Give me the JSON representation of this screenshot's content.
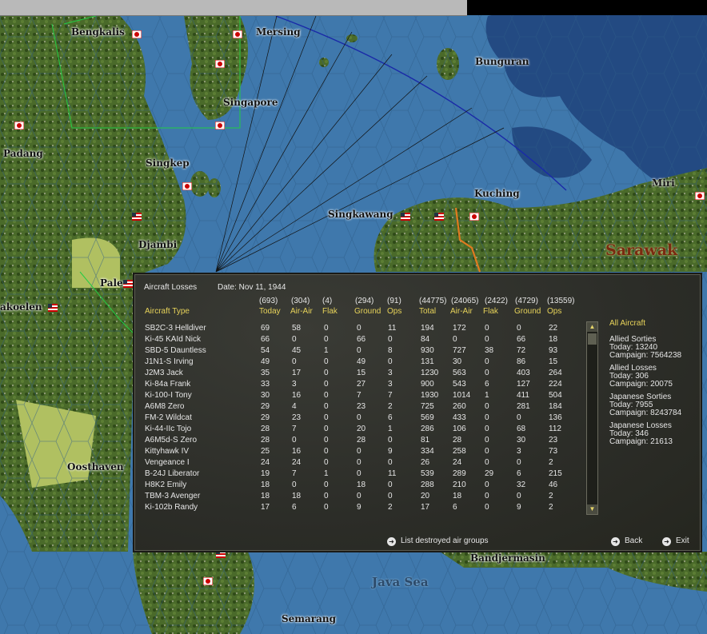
{
  "map": {
    "places": [
      {
        "name": "Bengkalis",
        "kind": "town"
      },
      {
        "name": "Mersing",
        "kind": "town"
      },
      {
        "name": "Bunguran",
        "kind": "town"
      },
      {
        "name": "Singapore",
        "kind": "town"
      },
      {
        "name": "Padang",
        "kind": "town"
      },
      {
        "name": "Singkep",
        "kind": "town"
      },
      {
        "name": "Kuching",
        "kind": "town"
      },
      {
        "name": "Miri",
        "kind": "town"
      },
      {
        "name": "Singkawang",
        "kind": "town"
      },
      {
        "name": "Djambi",
        "kind": "town"
      },
      {
        "name": "Sarawak",
        "kind": "region"
      },
      {
        "name": "Paler",
        "kind": "town"
      },
      {
        "name": "akoelen",
        "kind": "town"
      },
      {
        "name": "Oosthaven",
        "kind": "town"
      },
      {
        "name": "Bandjermasin",
        "kind": "town"
      },
      {
        "name": "Java Sea",
        "kind": "sea"
      },
      {
        "name": "Semarang",
        "kind": "town"
      }
    ],
    "colors": {
      "sea": "#3f78ac",
      "land": "#4c6e2c",
      "cloud": "#234a82",
      "hex_line": "#2d5c88",
      "green_zone": "#22cc44",
      "blue_arc": "#1a2aa8"
    }
  },
  "panel": {
    "title": "Aircraft Losses",
    "date": "Date: Nov 11, 1944",
    "totals": [
      "(693)",
      "(304)",
      "(4)",
      "(294)",
      "(91)",
      "(44775)",
      "(24065)",
      "(2422)",
      "(4729)",
      "(13559)"
    ],
    "col_label": "Aircraft Type",
    "columns": [
      "Today",
      "Air-Air",
      "Flak",
      "Ground",
      "Ops",
      "Total",
      "Air-Air",
      "Flak",
      "Ground",
      "Ops"
    ],
    "rows": [
      [
        "SB2C-3 Helldiver",
        "69",
        "58",
        "0",
        "0",
        "11",
        "194",
        "172",
        "0",
        "0",
        "22"
      ],
      [
        "Ki-45 KAId Nick",
        "66",
        "0",
        "0",
        "66",
        "0",
        "84",
        "0",
        "0",
        "66",
        "18"
      ],
      [
        "SBD-5 Dauntless",
        "54",
        "45",
        "1",
        "0",
        "8",
        "930",
        "727",
        "38",
        "72",
        "93"
      ],
      [
        "J1N1-S Irving",
        "49",
        "0",
        "0",
        "49",
        "0",
        "131",
        "30",
        "0",
        "86",
        "15"
      ],
      [
        "J2M3 Jack",
        "35",
        "17",
        "0",
        "15",
        "3",
        "1230",
        "563",
        "0",
        "403",
        "264"
      ],
      [
        "Ki-84a Frank",
        "33",
        "3",
        "0",
        "27",
        "3",
        "900",
        "543",
        "6",
        "127",
        "224"
      ],
      [
        "Ki-100-I Tony",
        "30",
        "16",
        "0",
        "7",
        "7",
        "1930",
        "1014",
        "1",
        "411",
        "504"
      ],
      [
        "A6M8 Zero",
        "29",
        "4",
        "0",
        "23",
        "2",
        "725",
        "260",
        "0",
        "281",
        "184"
      ],
      [
        "FM-2 Wildcat",
        "29",
        "23",
        "0",
        "0",
        "6",
        "569",
        "433",
        "0",
        "0",
        "136"
      ],
      [
        "Ki-44-IIc Tojo",
        "28",
        "7",
        "0",
        "20",
        "1",
        "286",
        "106",
        "0",
        "68",
        "112"
      ],
      [
        "A6M5d-S Zero",
        "28",
        "0",
        "0",
        "28",
        "0",
        "81",
        "28",
        "0",
        "30",
        "23"
      ],
      [
        "Kittyhawk IV",
        "25",
        "16",
        "0",
        "0",
        "9",
        "334",
        "258",
        "0",
        "3",
        "73"
      ],
      [
        "Vengeance I",
        "24",
        "24",
        "0",
        "0",
        "0",
        "26",
        "24",
        "0",
        "0",
        "2"
      ],
      [
        "B-24J Liberator",
        "19",
        "7",
        "1",
        "0",
        "11",
        "539",
        "289",
        "29",
        "6",
        "215"
      ],
      [
        "H8K2 Emily",
        "18",
        "0",
        "0",
        "18",
        "0",
        "288",
        "210",
        "0",
        "32",
        "46"
      ],
      [
        "TBM-3 Avenger",
        "18",
        "18",
        "0",
        "0",
        "0",
        "20",
        "18",
        "0",
        "0",
        "2"
      ],
      [
        "Ki-102b Randy",
        "17",
        "6",
        "0",
        "9",
        "2",
        "17",
        "6",
        "0",
        "9",
        "2"
      ]
    ],
    "side": {
      "filter": "All Aircraft",
      "blocks": [
        {
          "title": "Allied Sorties",
          "today": "Today:   13240",
          "campaign": "Campaign: 7564238"
        },
        {
          "title": "Allied Losses",
          "today": "Today:   306",
          "campaign": "Campaign: 20075"
        },
        {
          "title": "Japanese Sorties",
          "today": "Today:   7955",
          "campaign": "Campaign: 8243784"
        },
        {
          "title": "Japanese Losses",
          "today": "Today:   346",
          "campaign": "Campaign: 21613"
        }
      ]
    },
    "buttons": {
      "list": "List destroyed air groups",
      "back": "Back",
      "exit": "Exit"
    },
    "colors": {
      "header": "#e7d35a",
      "text": "#e6e6e6",
      "bg": "#2f302b"
    }
  }
}
